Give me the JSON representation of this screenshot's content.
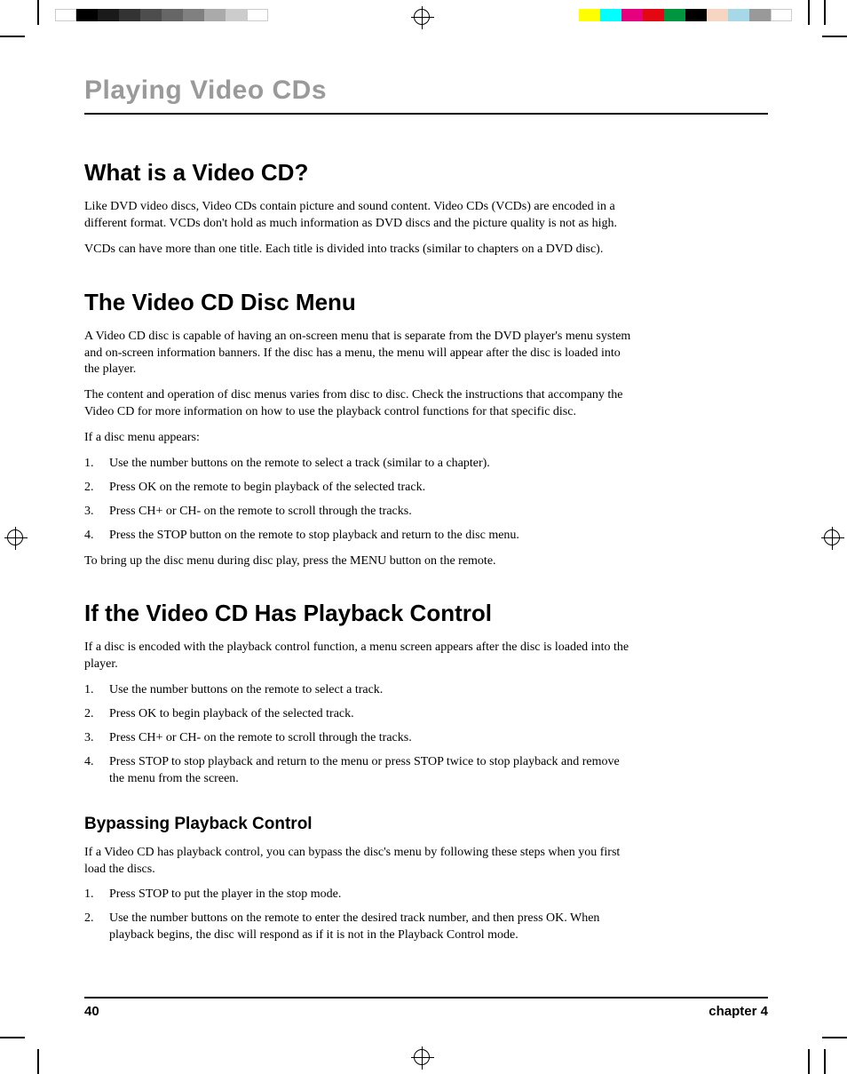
{
  "chapter_title": "Playing Video CDs",
  "sections": {
    "s1": {
      "heading": "What is a Video CD?",
      "p1": "Like DVD video discs, Video CDs contain picture and sound content. Video CDs (VCDs) are encoded in a different format. VCDs don't hold as much information as DVD discs and the picture quality is not as high.",
      "p2": "VCDs can have more than one title. Each title is divided into tracks (similar to chapters on a DVD disc)."
    },
    "s2": {
      "heading": "The Video CD Disc Menu",
      "p1": "A Video CD disc is capable of having an on-screen menu that is separate from the DVD player's menu system and on-screen information banners. If the disc has a menu, the menu will appear after the disc is loaded into the player.",
      "p2": "The content and operation of disc menus varies from disc to disc. Check the instructions that accompany the Video CD for more information on how to use the playback control functions for that specific disc.",
      "p3": " If a disc menu appears:",
      "list": [
        "Use the number buttons on the remote to select a track (similar to a chapter).",
        "Press OK on the remote to begin playback of the selected track.",
        "Press CH+ or CH- on the remote to scroll through the tracks.",
        "Press the STOP button on the remote to stop playback and return to the disc menu."
      ],
      "p4": "To bring up the disc menu during disc play, press the MENU button on the remote."
    },
    "s3": {
      "heading": "If the Video CD Has Playback Control",
      "p1": "If a disc is encoded with the playback control function, a menu screen appears after the disc is loaded into the player.",
      "list": [
        "Use the number buttons on the remote to select a track.",
        "Press OK to begin playback of the selected track.",
        "Press CH+ or CH- on the remote to scroll through the tracks.",
        "Press STOP to stop playback and return to the menu or press STOP twice to stop playback and remove the menu from the screen."
      ]
    },
    "s4": {
      "heading": "Bypassing Playback Control",
      "p1": "If a Video CD has playback control, you can bypass the disc's menu by following these steps when you first load the discs.",
      "list": [
        "Press STOP to put the player in the stop mode.",
        "Use the number buttons on the remote to enter the desired track number, and then press OK. When playback begins, the disc will respond as if it is not in the Playback Control mode."
      ]
    }
  },
  "footer": {
    "page_number": "40",
    "chapter": "chapter 4"
  }
}
